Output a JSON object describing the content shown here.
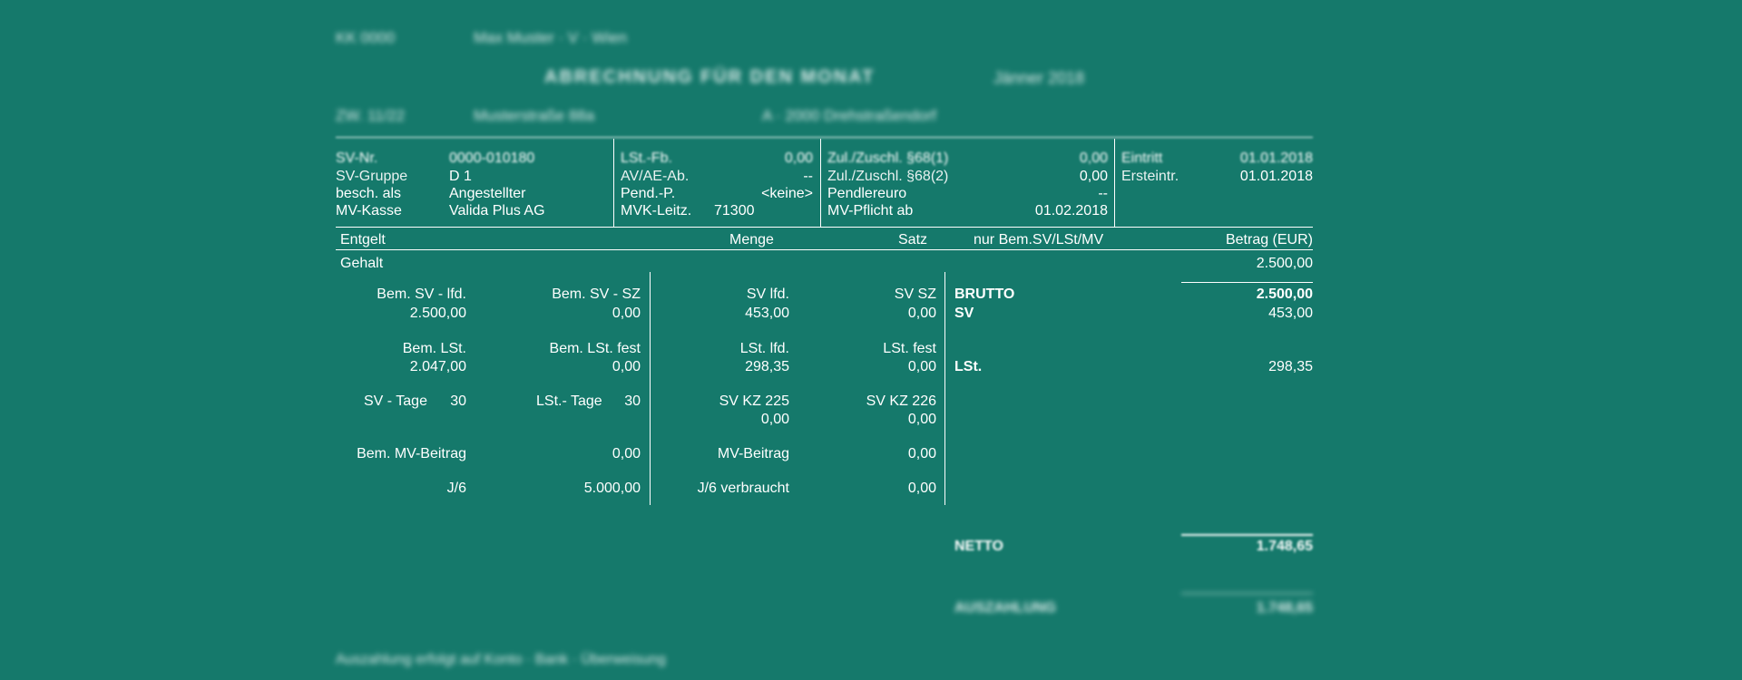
{
  "header": {
    "line1_left": "KK 0000",
    "line1_right": "Max Muster · V · Wien",
    "title": "ABRECHNUNG FÜR DEN MONAT",
    "title_period": "Jänner 2018",
    "line3_left": "ZW. 11/22",
    "line3_mid": "Musterstraße 88a",
    "line3_right": "A · 2000 Drehstraßendorf"
  },
  "info": {
    "col1": [
      {
        "label": "SV-Nr.",
        "value": "0000-010180"
      },
      {
        "label": "SV-Gruppe",
        "value": "D 1"
      },
      {
        "label": "besch. als",
        "value": "Angestellter"
      },
      {
        "label": "MV-Kasse",
        "value": "Valida Plus AG"
      }
    ],
    "col2": [
      {
        "label": "LSt.-Fb.",
        "value": "0,00"
      },
      {
        "label": "AV/AE-Ab.",
        "value": "--"
      },
      {
        "label": "Pend.-P.",
        "value": "<keine>"
      },
      {
        "label": "MVK-Leitz.",
        "value": "71300"
      }
    ],
    "col3": [
      {
        "label": "Zul./Zuschl. §68(1)",
        "value": "0,00"
      },
      {
        "label": "Zul./Zuschl. §68(2)",
        "value": "0,00"
      },
      {
        "label": "Pendlereuro",
        "value": "--"
      },
      {
        "label": "MV-Pflicht ab",
        "value": "01.02.2018"
      }
    ],
    "col4": [
      {
        "label": "Eintritt",
        "value": "01.01.2018"
      },
      {
        "label": "Ersteintr.",
        "value": "01.01.2018"
      }
    ]
  },
  "table_header": {
    "entgelt": "Entgelt",
    "menge": "Menge",
    "satz": "Satz",
    "bem": "nur Bem.SV/LSt/MV",
    "betrag": "Betrag (EUR)"
  },
  "row_gehalt": {
    "label": "Gehalt",
    "amount": "2.500,00"
  },
  "calc": {
    "c1": [
      {
        "label": "Bem. SV - lfd.",
        "value": "2.500,00"
      },
      {
        "label": "Bem. LSt.",
        "value": "2.047,00"
      },
      {
        "label": "SV - Tage",
        "value": "30"
      },
      {
        "label": "Bem. MV-Beitrag"
      },
      {
        "label": "J/6"
      }
    ],
    "c2": [
      {
        "label": "Bem. SV - SZ",
        "value": "0,00"
      },
      {
        "label": "Bem. LSt. fest",
        "value": "0,00"
      },
      {
        "label": "LSt.- Tage",
        "value": "30"
      },
      {
        "value": "0,00"
      },
      {
        "value": "5.000,00"
      }
    ],
    "c3": [
      {
        "label": "SV lfd.",
        "value": "453,00"
      },
      {
        "label": "LSt. lfd.",
        "value": "298,35"
      },
      {
        "label": "SV KZ 225",
        "value": "0,00"
      },
      {
        "label": "MV-Beitrag"
      },
      {
        "label": "J/6 verbraucht"
      }
    ],
    "c4": [
      {
        "label": "SV SZ",
        "value": "0,00"
      },
      {
        "label": "LSt. fest",
        "value": "0,00"
      },
      {
        "label": "SV KZ 226",
        "value": "0,00"
      },
      {
        "value": "0,00"
      },
      {
        "value": "0,00"
      }
    ]
  },
  "summary": {
    "brutto_label": "BRUTTO",
    "brutto_value": "2.500,00",
    "sv_label": "SV",
    "sv_value": "453,00",
    "lst_label": "LSt.",
    "lst_value": "298,35",
    "netto_label": "NETTO",
    "netto_value": "1.748,65",
    "auszahlung_label": "AUSZAHLUNG",
    "auszahlung_value": "1.748,65"
  },
  "footer": "Auszahlung erfolgt auf Konto · Bank · Überweisung"
}
